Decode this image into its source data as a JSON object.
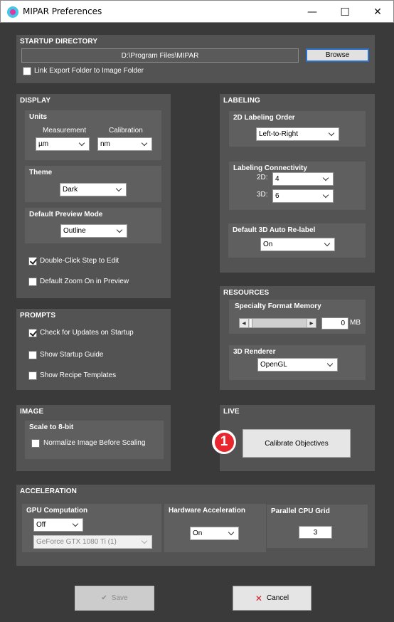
{
  "window": {
    "title": "MIPAR Preferences",
    "minimize_glyph": "—",
    "maximize_glyph": "☐",
    "close_glyph": "✕"
  },
  "startup": {
    "title": "STARTUP DIRECTORY",
    "path": "D:\\Program Files\\MIPAR",
    "browse_label": "Browse",
    "link_export_label": "Link Export Folder to Image Folder",
    "link_export_checked": false
  },
  "display": {
    "title": "DISPLAY",
    "units": {
      "title": "Units",
      "measurement_label": "Measurement",
      "measurement_value": "µm",
      "calibration_label": "Calibration",
      "calibration_value": "nm"
    },
    "theme": {
      "title": "Theme",
      "value": "Dark"
    },
    "preview": {
      "title": "Default Preview Mode",
      "value": "Outline"
    },
    "double_click_label": "Double-Click Step to Edit",
    "double_click_checked": true,
    "zoom_label": "Default Zoom On in Preview",
    "zoom_checked": false
  },
  "labeling": {
    "title": "LABELING",
    "order": {
      "title": "2D Labeling Order",
      "value": "Left-to-Right"
    },
    "connectivity": {
      "title": "Labeling Connectivity",
      "label_2d": "2D:",
      "value_2d": "4",
      "label_3d": "3D:",
      "value_3d": "6"
    },
    "relabel": {
      "title": "Default 3D Auto Re-label",
      "value": "On"
    }
  },
  "resources": {
    "title": "RESOURCES",
    "memory": {
      "title": "Specialty Format Memory",
      "value": "0",
      "unit": "MB",
      "left_glyph": "◂",
      "right_glyph": "▸"
    },
    "renderer": {
      "title": "3D Renderer",
      "value": "OpenGL"
    }
  },
  "prompts": {
    "title": "PROMPTS",
    "updates_label": "Check for Updates on Startup",
    "updates_checked": true,
    "guide_label": "Show Startup Guide",
    "guide_checked": false,
    "recipes_label": "Show Recipe Templates",
    "recipes_checked": false
  },
  "image": {
    "title": "IMAGE",
    "scale": {
      "title": "Scale to 8-bit",
      "normalize_label": "Normalize Image Before Scaling",
      "normalize_checked": false
    }
  },
  "live": {
    "title": "LIVE",
    "calibrate_label": "Calibrate Objectives",
    "callout_number": "1",
    "callout_color": "#e8262d"
  },
  "acceleration": {
    "title": "ACCELERATION",
    "gpu": {
      "title": "GPU Computation",
      "value": "Off",
      "device": "GeForce GTX 1080 Ti (1)"
    },
    "hardware": {
      "title": "Hardware Acceleration",
      "value": "On"
    },
    "cpu_grid": {
      "title": "Parallel CPU Grid",
      "value": "3"
    }
  },
  "footer": {
    "save_label": "Save",
    "save_icon": "✔",
    "cancel_label": "Cancel",
    "cancel_icon": "✕",
    "cancel_icon_color": "#d0202a"
  }
}
